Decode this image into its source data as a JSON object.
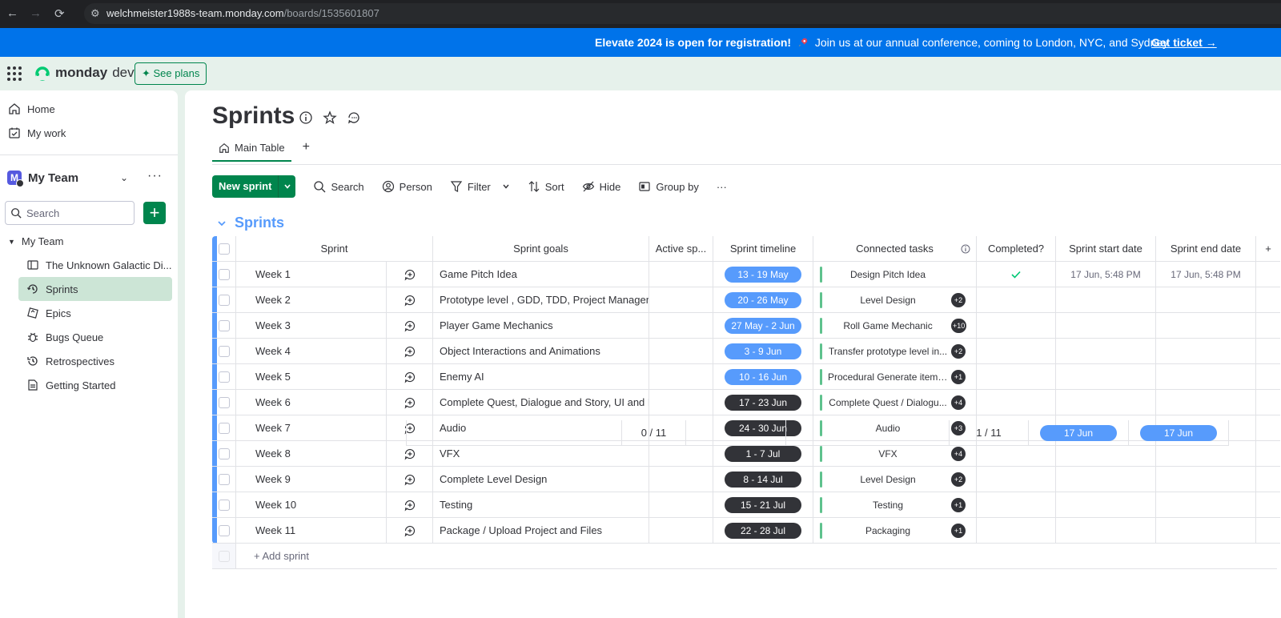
{
  "browser": {
    "url_host": "welchmeister1988s-team.monday.com",
    "url_path": "/boards/1535601807"
  },
  "banner": {
    "bold_text": "Elevate 2024 is open for registration!",
    "text": "Join us at our annual conference, coming to London, NYC, and Sydney",
    "cta": "Get ticket →"
  },
  "header": {
    "brand": "monday",
    "product": "dev",
    "see_plans": "See plans"
  },
  "sidebar": {
    "home": "Home",
    "my_work": "My work",
    "team_name": "My Team",
    "team_initial": "M",
    "search_placeholder": "Search",
    "workspace": "My Team",
    "items": [
      {
        "label": "The Unknown Galactic Di...",
        "icon": "table-icon",
        "active": false
      },
      {
        "label": "Sprints",
        "icon": "sprint-icon",
        "active": true
      },
      {
        "label": "Epics",
        "icon": "epic-icon",
        "active": false
      },
      {
        "label": "Bugs Queue",
        "icon": "bug-icon",
        "active": false
      },
      {
        "label": "Retrospectives",
        "icon": "retro-icon",
        "active": false
      },
      {
        "label": "Getting Started",
        "icon": "doc-icon",
        "active": false
      }
    ]
  },
  "board": {
    "title": "Sprints",
    "tab": "Main Table",
    "tab_add": "+",
    "toolbar": {
      "new_item": "New sprint",
      "search": "Search",
      "person": "Person",
      "filter": "Filter",
      "sort": "Sort",
      "hide": "Hide",
      "group_by": "Group by",
      "more": "···"
    },
    "group": "Sprints",
    "columns": {
      "name": "Sprint",
      "goals": "Sprint goals",
      "active": "Active sp...",
      "timeline": "Sprint timeline",
      "connected": "Connected tasks",
      "completed": "Completed?",
      "start": "Sprint start date",
      "end": "Sprint end date",
      "add": "+"
    },
    "rows": [
      {
        "name": "Week 1",
        "goal": "Game Pitch Idea",
        "timeline": "13 - 19 May",
        "timeline_status": "past",
        "task": "Design Pitch Idea",
        "extra": "",
        "completed": true,
        "start": "17 Jun, 5:48 PM",
        "end": "17 Jun, 5:48 PM"
      },
      {
        "name": "Week 2",
        "goal": "Prototype level , GDD, TDD, Project Manageme...",
        "timeline": "20 - 26 May",
        "timeline_status": "past",
        "task": "Level Design",
        "extra": "+2",
        "completed": false,
        "start": "",
        "end": ""
      },
      {
        "name": "Week 3",
        "goal": "Player Game Mechanics",
        "timeline": "27 May - 2 Jun",
        "timeline_status": "past",
        "task": "Roll Game Mechanic",
        "extra": "+10",
        "completed": false,
        "start": "",
        "end": ""
      },
      {
        "name": "Week 4",
        "goal": "Object Interactions and Animations",
        "timeline": "3 - 9 Jun",
        "timeline_status": "past",
        "task": "Transfer prototype level in...",
        "extra": "+2",
        "completed": false,
        "start": "",
        "end": ""
      },
      {
        "name": "Week 5",
        "goal": "Enemy AI",
        "timeline": "10 - 16 Jun",
        "timeline_status": "past",
        "task": "Procedural Generate item ...",
        "extra": "+1",
        "completed": false,
        "start": "",
        "end": ""
      },
      {
        "name": "Week 6",
        "goal": "Complete Quest, Dialogue and Story, UI and M...",
        "timeline": "17 - 23 Jun",
        "timeline_status": "future",
        "task": "Complete Quest / Dialogu...",
        "extra": "+4",
        "completed": false,
        "start": "",
        "end": ""
      },
      {
        "name": "Week 7",
        "goal": "Audio",
        "timeline": "24 - 30 Jun",
        "timeline_status": "future",
        "task": "Audio",
        "extra": "+3",
        "completed": false,
        "start": "",
        "end": ""
      },
      {
        "name": "Week 8",
        "goal": "VFX",
        "timeline": "1 - 7 Jul",
        "timeline_status": "future",
        "task": "VFX",
        "extra": "+4",
        "completed": false,
        "start": "",
        "end": ""
      },
      {
        "name": "Week 9",
        "goal": "Complete Level Design",
        "timeline": "8 - 14 Jul",
        "timeline_status": "future",
        "task": "Level Design",
        "extra": "+2",
        "completed": false,
        "start": "",
        "end": ""
      },
      {
        "name": "Week 10",
        "goal": "Testing",
        "timeline": "15 - 21 Jul",
        "timeline_status": "future",
        "task": "Testing",
        "extra": "+1",
        "completed": false,
        "start": "",
        "end": ""
      },
      {
        "name": "Week 11",
        "goal": "Package / Upload Project and Files",
        "timeline": "22 - 28 Jul",
        "timeline_status": "future",
        "task": "Packaging",
        "extra": "+1",
        "completed": false,
        "start": "",
        "end": ""
      }
    ],
    "add_item": "+ Add sprint",
    "summary": {
      "active": "0 / 11",
      "completed": "1 / 11",
      "start": "17 Jun",
      "end": "17 Jun"
    }
  },
  "colors": {
    "accent_green": "#00854d",
    "group_blue": "#579bfc",
    "past_pill": "#579bfc",
    "future_pill": "#323338",
    "banner_blue": "#0073ea"
  }
}
